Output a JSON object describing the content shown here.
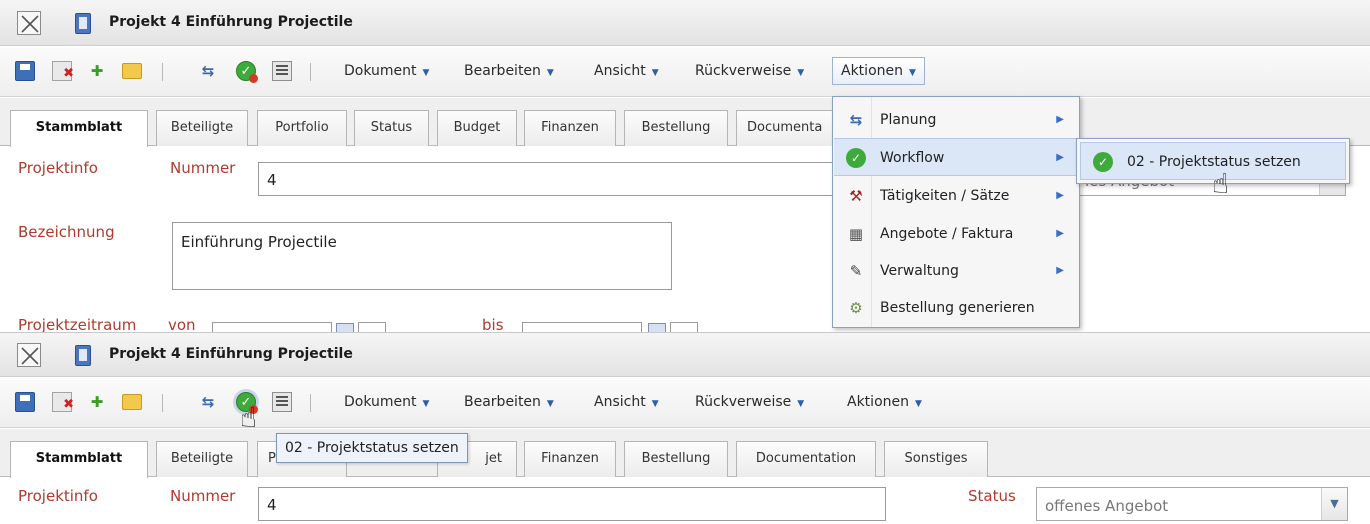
{
  "window": {
    "title": "Projekt 4 Einführung Projectile"
  },
  "toolbar": {
    "menus": [
      "Dokument",
      "Bearbeiten",
      "Ansicht",
      "Rückverweise",
      "Aktionen"
    ]
  },
  "tabs": {
    "panel1": [
      "Stammblatt",
      "Beteiligte",
      "Portfolio",
      "Status",
      "Budget",
      "Finanzen",
      "Bestellung",
      "Documenta"
    ],
    "panel2": [
      "Stammblatt",
      "Beteiligte",
      "P",
      "jet",
      "Finanzen",
      "Bestellung",
      "Documentation",
      "Sonstiges"
    ]
  },
  "form": {
    "projektinfo_label": "Projektinfo",
    "nummer_label": "Nummer",
    "nummer_value": "4",
    "bezeichnung_label": "Bezeichnung",
    "bezeichnung_value": "Einführung Projectile",
    "zeitraum_label": "Projektzeitraum",
    "von_label": "von",
    "bis_label": "bis",
    "status_label": "Status",
    "status_value": "offenes Angebot",
    "status_value_partial": "les Angebot"
  },
  "aktionen_menu": {
    "items": [
      "Planung",
      "Workflow",
      "Tätigkeiten / Sätze",
      "Angebote / Faktura",
      "Verwaltung",
      "Bestellung generieren"
    ],
    "hovered": "Workflow"
  },
  "workflow_submenu": {
    "items": [
      "02 - Projektstatus setzen"
    ]
  },
  "tooltip": {
    "text": "02 - Projektstatus setzen"
  },
  "colors": {
    "label_red": "#b13a2d",
    "menu_highlight": "#dbe6f6",
    "accent_blue": "#3a6fc0"
  }
}
